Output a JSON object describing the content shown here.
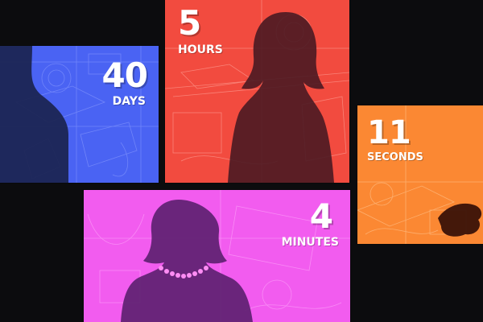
{
  "colors": {
    "background": "#0c0c0e",
    "blue": "#4a63f3",
    "red": "#f24b3f",
    "orange": "#fb8833",
    "magenta": "#f25cef",
    "silhouette_blue": "#1a234f",
    "silhouette_red": "#4a1a22",
    "silhouette_orange": "#3a1208",
    "silhouette_magenta": "#5b1f6e"
  },
  "panels": [
    {
      "id": "days",
      "number": "40",
      "unit": "DAYS",
      "color": "blue",
      "silhouette": "man-shoulder-silhouette"
    },
    {
      "id": "hours",
      "number": "5",
      "unit": "HOURS",
      "color": "red",
      "silhouette": "woman-bob-silhouette"
    },
    {
      "id": "seconds",
      "number": "11",
      "unit": "SECONDS",
      "color": "orange",
      "silhouette": "hat-silhouette"
    },
    {
      "id": "minutes",
      "number": "4",
      "unit": "MINUTES",
      "color": "magenta",
      "silhouette": "woman-pearls-silhouette"
    }
  ]
}
